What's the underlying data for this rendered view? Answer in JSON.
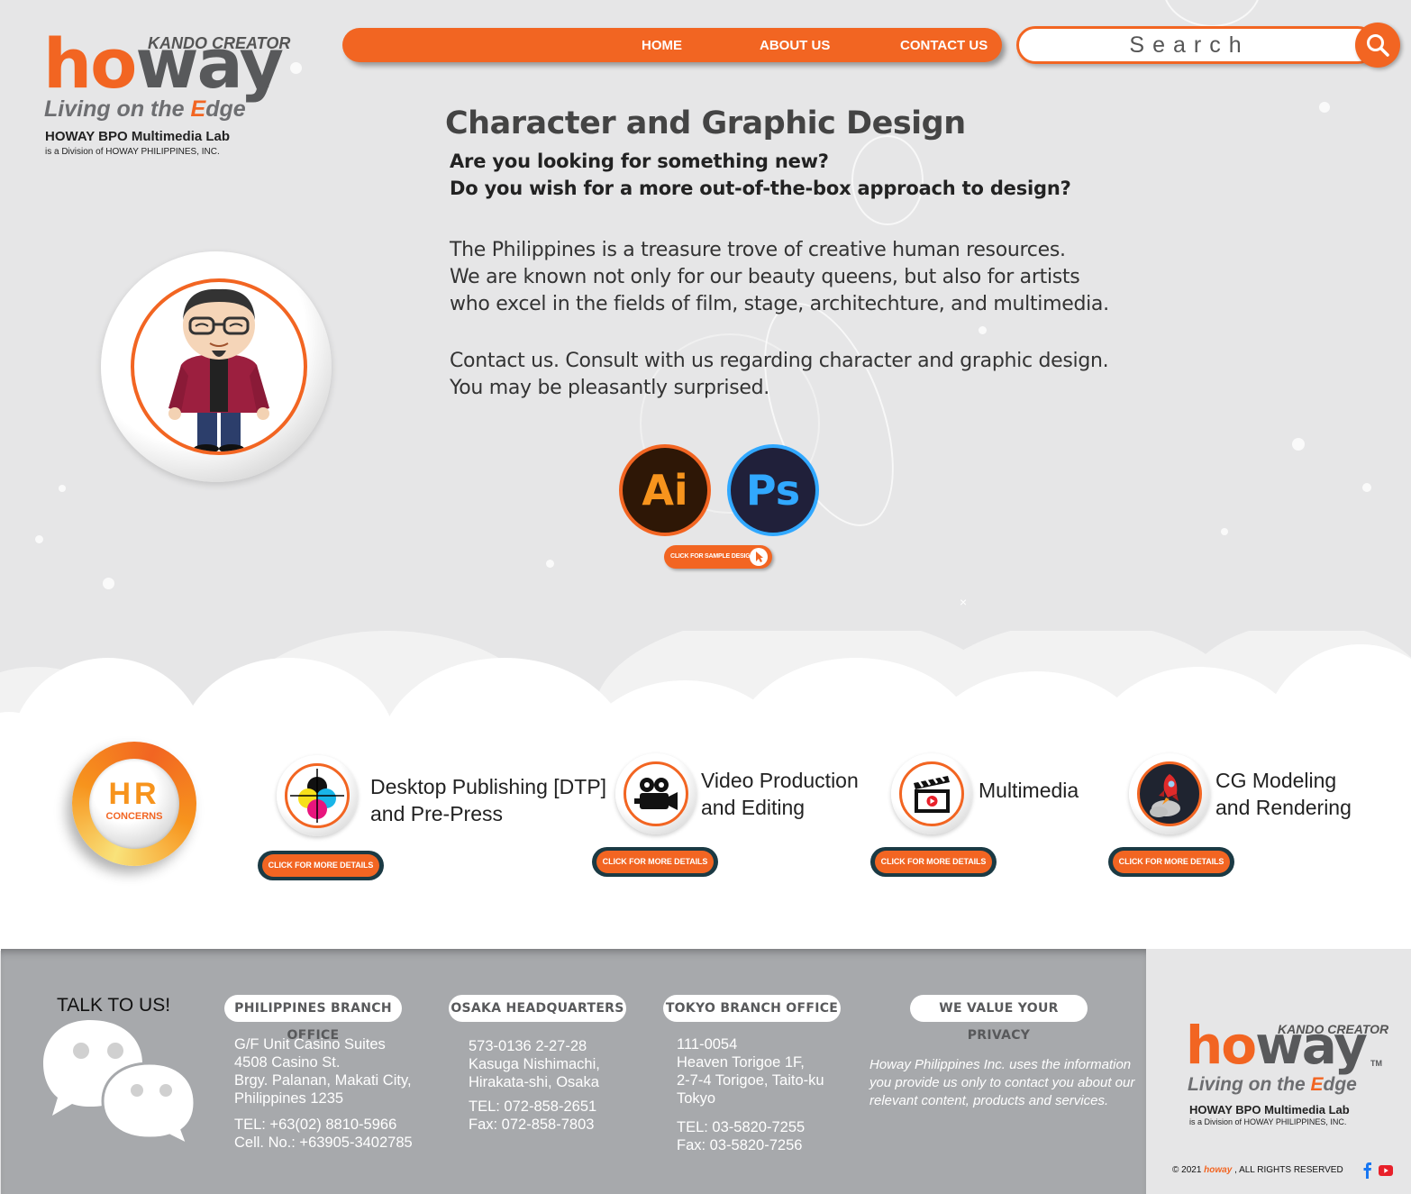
{
  "brand": {
    "kando": "KANDO CREATOR",
    "word_h": "h",
    "word_o": "o",
    "word_way": "way",
    "tm": "TM",
    "slogan_pre": "Living on the ",
    "slogan_e": "E",
    "slogan_post": "dge",
    "lab": "HOWAY BPO Multimedia Lab",
    "division": "is a Division of HOWAY PHILIPPINES, INC."
  },
  "nav": {
    "items": [
      "HOME",
      "ABOUT US",
      "CONTACT US"
    ]
  },
  "search": {
    "placeholder": "Search"
  },
  "main": {
    "title": "Character and Graphic Design",
    "questions": [
      "Are you looking for something new?",
      "Do you wish for a more out-of-the-box approach to design?"
    ],
    "paragraph1": [
      "The Philippines is a treasure trove of creative human resources.",
      "We are known not only for our beauty queens, but also for artists",
      "who excel in the fields of film, stage, architechture, and multimedia."
    ],
    "paragraph2": [
      "Contact us. Consult with us regarding character and graphic design.",
      "You may be pleasantly surprised."
    ],
    "apps": [
      "Ai",
      "Ps"
    ],
    "sample_button": "CLICK FOR SAMPLE DESIGN",
    "close_mark": "×"
  },
  "hr": {
    "big": "HR",
    "small": "CONCERNS"
  },
  "services": [
    {
      "line1": "Desktop Publishing [DTP]",
      "line2": "and Pre-Press",
      "button": "CLICK FOR MORE DETAILS",
      "icon": "cmyk-icon"
    },
    {
      "line1": "Video Production",
      "line2": "and Editing",
      "button": "CLICK FOR MORE DETAILS",
      "icon": "video-camera-icon"
    },
    {
      "line1": "Multimedia",
      "line2": "",
      "button": "CLICK FOR MORE DETAILS",
      "icon": "clapperboard-icon"
    },
    {
      "line1": "CG Modeling",
      "line2": "and Rendering",
      "button": "CLICK FOR MORE DETAILS",
      "icon": "rocket-icon"
    }
  ],
  "footer": {
    "talk": "TALK TO US!",
    "ph": {
      "heading": "PHILIPPINES BRANCH OFFICE",
      "address": [
        "G/F Unit Casino Suites",
        "4508 Casino St.",
        "Brgy. Palanan, Makati City,",
        "Philippines 1235"
      ],
      "contact": [
        "TEL: +63(02) 8810-5966",
        "Cell. No.: +63905-3402785"
      ]
    },
    "osaka": {
      "heading": "OSAKA HEADQUARTERS",
      "address": [
        "573-0136 2-27-28",
        "Kasuga Nishimachi,",
        "Hirakata-shi, Osaka"
      ],
      "contact": [
        "TEL: 072-858-2651",
        "Fax: 072-858-7803"
      ]
    },
    "tokyo": {
      "heading": "TOKYO BRANCH OFFICE",
      "address": [
        "111-0054",
        "Heaven Torigoe 1F,",
        "2-7-4 Torigoe, Taito-ku",
        "Tokyo"
      ],
      "contact": [
        "TEL: 03-5820-7255",
        "Fax: 03-5820-7256"
      ]
    },
    "privacy": {
      "heading": "WE VALUE YOUR PRIVACY",
      "text": "Howay Philippines Inc. uses the information you provide  us only to contact you about our relevant content, products and services."
    },
    "copyright_pre": "© 2021 ",
    "copyright_brand": "howay",
    "copyright_post": " , ALL RIGHTS RESERVED"
  },
  "colors": {
    "accent": "#f26522",
    "dark_teal": "#1b3a44",
    "footer_gray": "#a7a9ac",
    "background": "#e6e6e7"
  }
}
